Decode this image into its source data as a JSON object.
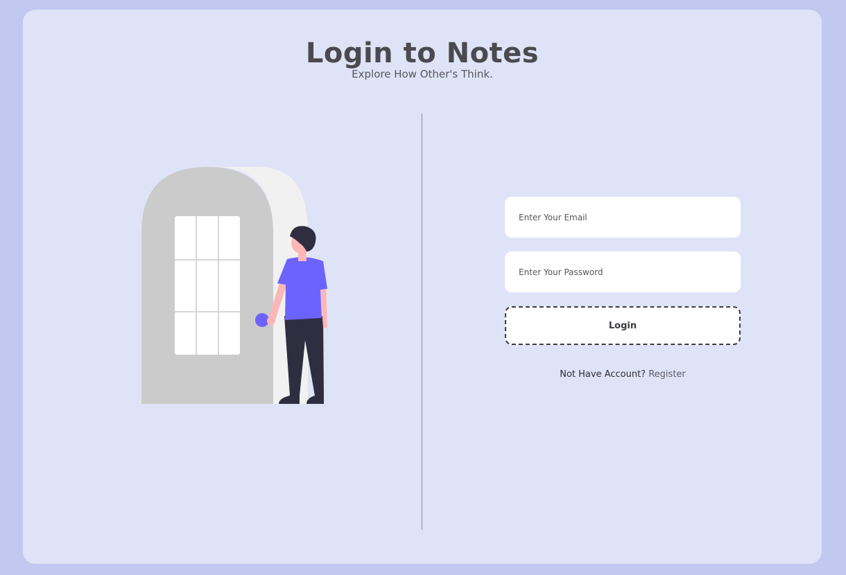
{
  "header": {
    "title": "Login to Notes",
    "subtitle": "Explore How Other's Think."
  },
  "login_form": {
    "email_placeholder": "Enter Your Email",
    "email_value": "",
    "password_placeholder": "Enter Your Password",
    "password_value": "",
    "login_button_label": "Login",
    "register_prompt": "Not Have Account?",
    "register_link_label": "Register"
  },
  "illustration": {
    "name": "person-at-door-illustration"
  },
  "colors": {
    "page_background": "#c2c9f0",
    "card_background": "#dfe3f7",
    "accent": "#6c63ff",
    "title_text": "#4a4a4f"
  }
}
